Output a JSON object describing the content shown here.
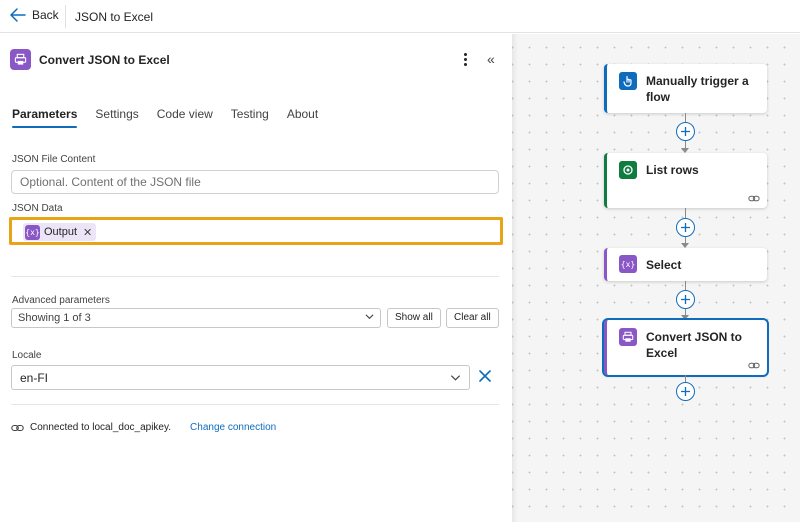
{
  "topbar": {
    "back_label": "Back",
    "title": "JSON to Excel"
  },
  "panel": {
    "title": "Convert JSON to Excel",
    "tabs": [
      {
        "label": "Parameters",
        "active": true
      },
      {
        "label": "Settings",
        "active": false
      },
      {
        "label": "Code view",
        "active": false
      },
      {
        "label": "Testing",
        "active": false
      },
      {
        "label": "About",
        "active": false
      }
    ],
    "json_file_content": {
      "label": "JSON File Content",
      "placeholder": "Optional. Content of the JSON file"
    },
    "json_data": {
      "label": "JSON Data",
      "token_label": "Output",
      "token_icon": "{x}"
    },
    "advanced": {
      "label": "Advanced parameters",
      "value": "Showing 1 of 3",
      "show_all": "Show all",
      "clear_all": "Clear all"
    },
    "locale": {
      "label": "Locale",
      "value": "en-FI"
    },
    "connection": {
      "text": "Connected to local_doc_apikey.",
      "change_label": "Change connection"
    }
  },
  "flow": {
    "cards": [
      {
        "label": "Manually trigger a flow",
        "accent": "#0f6cbd",
        "icon": "hand-pointer-icon"
      },
      {
        "label": "List rows",
        "accent": "#107c41",
        "icon": "dataverse-icon"
      },
      {
        "label": "Select",
        "accent": "#8a57c7",
        "icon": "variable-icon"
      },
      {
        "label": "Convert JSON to Excel",
        "accent": "#8a57c7",
        "icon": "printer-icon"
      }
    ]
  },
  "colors": {
    "accent": "#0f6cbd",
    "highlight": "#e8a317",
    "purple": "#8a57c7",
    "green": "#107c41"
  }
}
